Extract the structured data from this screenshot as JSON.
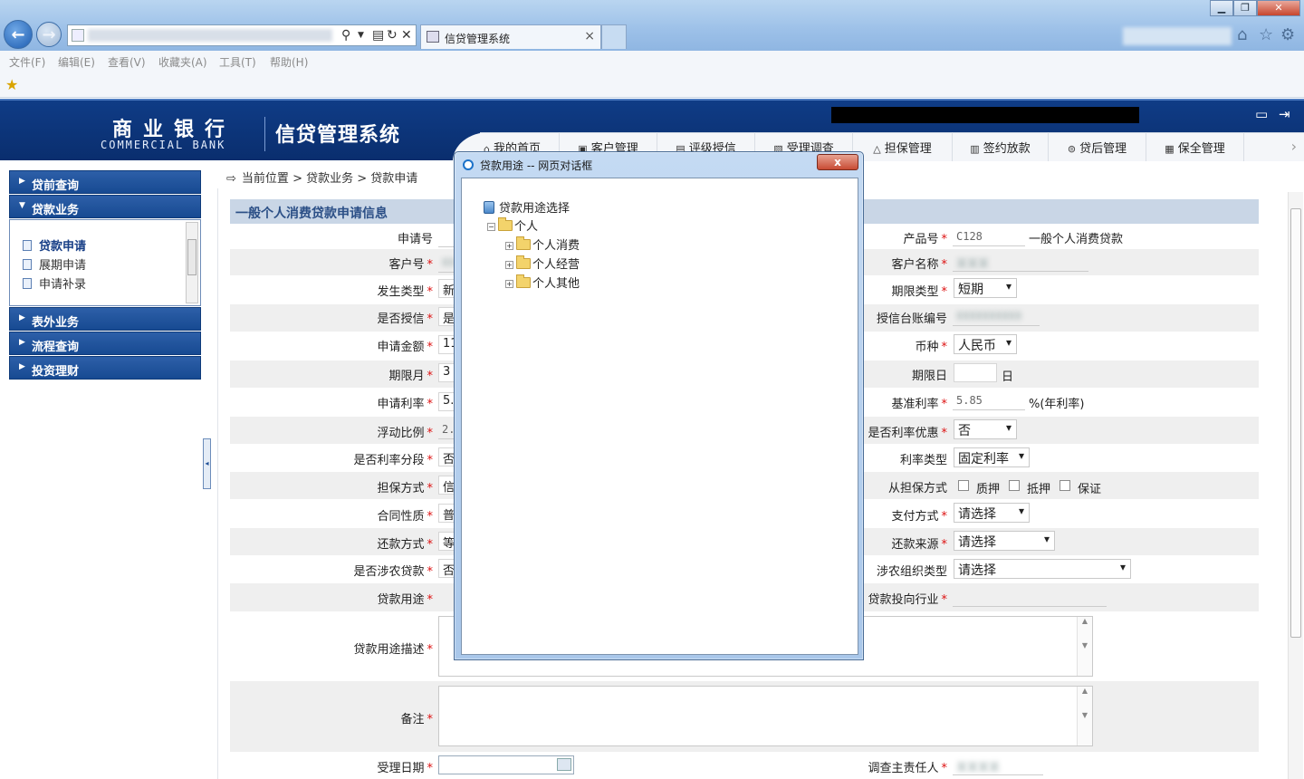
{
  "browser": {
    "tab_title": "信贷管理系统",
    "menu": [
      "文件(F)",
      "编辑(E)",
      "查看(V)",
      "收藏夹(A)",
      "工具(T)",
      "帮助(H)"
    ]
  },
  "header": {
    "bank_name": "商业银行",
    "bank_name_en": "COMMERCIAL BANK",
    "system_title": "信贷管理系统",
    "nav_tabs": [
      {
        "label": "我的首页",
        "icon": "home-icon"
      },
      {
        "label": "客户管理",
        "icon": "customer-icon"
      },
      {
        "label": "评级授信",
        "icon": "rating-icon"
      },
      {
        "label": "受理调查",
        "icon": "survey-icon"
      },
      {
        "label": "担保管理",
        "icon": "guarantee-icon"
      },
      {
        "label": "签约放款",
        "icon": "contract-icon"
      },
      {
        "label": "贷后管理",
        "icon": "post-loan-icon"
      },
      {
        "label": "保全管理",
        "icon": "preservation-icon"
      }
    ]
  },
  "sidebar": {
    "sections": [
      "贷前查询",
      "贷款业务",
      "表外业务",
      "流程查询",
      "投资理财"
    ],
    "sub_items": [
      "贷款申请",
      "展期申请",
      "申请补录"
    ]
  },
  "breadcrumb": {
    "label": "当前位置",
    "path": [
      "贷款业务",
      "贷款申请"
    ]
  },
  "form": {
    "title": "一般个人消费贷款申请信息",
    "left_labels": [
      "申请号",
      "客户号",
      "发生类型",
      "是否授信",
      "申请金额",
      "期限月",
      "申请利率",
      "浮动比例",
      "是否利率分段",
      "担保方式",
      "合同性质",
      "还款方式",
      "是否涉农贷款",
      "贷款用途"
    ],
    "left_values": [
      "",
      "",
      "新",
      "是",
      "11",
      "3",
      "5.",
      "2.9",
      "否",
      "信",
      "普",
      "等",
      "否",
      ""
    ],
    "right_labels": [
      "产品号",
      "客户名称",
      "期限类型",
      "授信台账编号",
      "币种",
      "期限日",
      "基准利率",
      "是否利率优惠",
      "利率类型",
      "从担保方式",
      "支付方式",
      "还款来源",
      "涉农组织类型",
      "贷款投向行业"
    ],
    "product_code": "C128",
    "product_name": "一般个人消费贷款",
    "term_type": "短期",
    "currency": "人民币",
    "term_day_value": "",
    "term_day_unit": "日",
    "base_rate": "5.85",
    "base_rate_unit": "%(年利率)",
    "rate_discount": "否",
    "rate_type": "固定利率",
    "secondary_guarantee": [
      "质押",
      "抵押",
      "保证"
    ],
    "payment_method": "请选择",
    "repayment_source": "请选择",
    "agri_org_type": "请选择",
    "purpose_desc_label": "贷款用途描述",
    "remark_label": "备注",
    "accept_date_label": "受理日期",
    "investigator_label": "调查主责任人"
  },
  "dialog": {
    "title": "贷款用途 -- 网页对话框",
    "close": "x",
    "tree_root": "贷款用途选择",
    "tree_level1": "个人",
    "tree_children": [
      "个人消费",
      "个人经营",
      "个人其他"
    ]
  }
}
